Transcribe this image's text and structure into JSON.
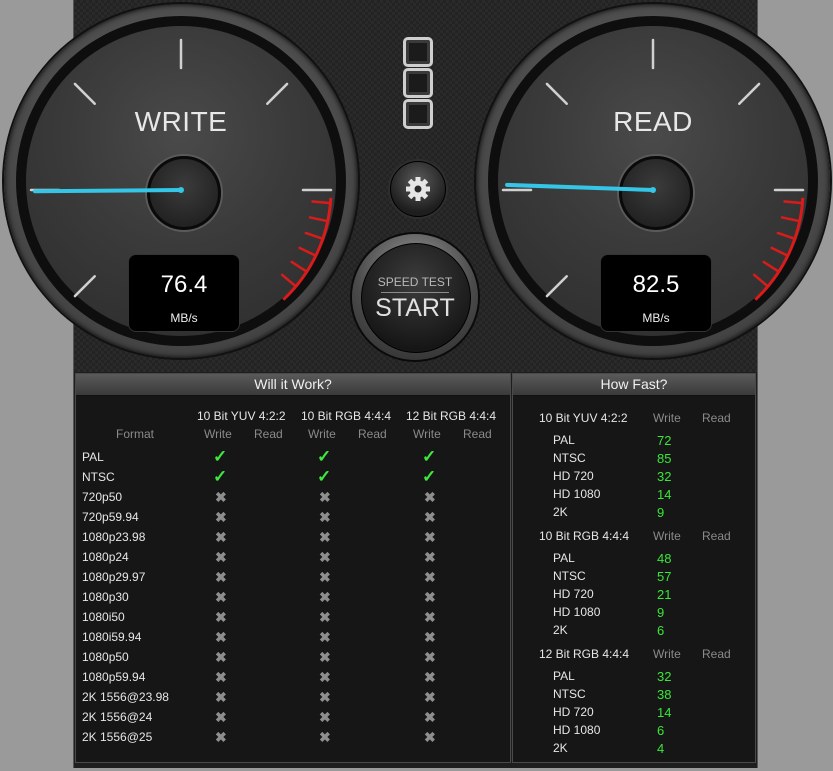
{
  "write_gauge": {
    "title": "WRITE",
    "value": "76.4",
    "unit": "MB/s"
  },
  "read_gauge": {
    "title": "READ",
    "value": "82.5",
    "unit": "MB/s"
  },
  "controls": {
    "speed_test_label": "SPEED TEST",
    "start_label": "START",
    "settings_icon": "gear-icon"
  },
  "will_it_work": {
    "title": "Will it Work?",
    "format_header": "Format",
    "groups": [
      {
        "name": "10 Bit YUV 4:2:2",
        "write": "Write",
        "read": "Read"
      },
      {
        "name": "10 Bit RGB 4:4:4",
        "write": "Write",
        "read": "Read"
      },
      {
        "name": "12 Bit RGB 4:4:4",
        "write": "Write",
        "read": "Read"
      }
    ],
    "formats": [
      "PAL",
      "NTSC",
      "720p50",
      "720p59.94",
      "1080p23.98",
      "1080p24",
      "1080p29.97",
      "1080p30",
      "1080i50",
      "1080i59.94",
      "1080p50",
      "1080p59.94",
      "2K 1556@23.98",
      "2K 1556@24",
      "2K 1556@25"
    ],
    "write_ok": [
      true,
      true,
      false,
      false,
      false,
      false,
      false,
      false,
      false,
      false,
      false,
      false,
      false,
      false,
      false
    ],
    "check_glyph": "✓",
    "cross_glyph": "✖"
  },
  "how_fast": {
    "title": "How Fast?",
    "sections": [
      {
        "name": "10 Bit YUV 4:2:2",
        "write": "Write",
        "read": "Read",
        "rows": [
          {
            "label": "PAL",
            "value": "72"
          },
          {
            "label": "NTSC",
            "value": "85"
          },
          {
            "label": "HD 720",
            "value": "32"
          },
          {
            "label": "HD 1080",
            "value": "14"
          },
          {
            "label": "2K",
            "value": "9"
          }
        ]
      },
      {
        "name": "10 Bit RGB 4:4:4",
        "write": "Write",
        "read": "Read",
        "rows": [
          {
            "label": "PAL",
            "value": "48"
          },
          {
            "label": "NTSC",
            "value": "57"
          },
          {
            "label": "HD 720",
            "value": "21"
          },
          {
            "label": "HD 1080",
            "value": "9"
          },
          {
            "label": "2K",
            "value": "6"
          }
        ]
      },
      {
        "name": "12 Bit RGB 4:4:4",
        "write": "Write",
        "read": "Read",
        "rows": [
          {
            "label": "PAL",
            "value": "32"
          },
          {
            "label": "NTSC",
            "value": "38"
          },
          {
            "label": "HD 720",
            "value": "14"
          },
          {
            "label": "HD 1080",
            "value": "6"
          },
          {
            "label": "2K",
            "value": "4"
          }
        ]
      }
    ]
  },
  "colors": {
    "needle": "#34c6e6",
    "redline": "#d81c1c",
    "ok_green": "#3fe83f",
    "value_green": "#39e639"
  }
}
